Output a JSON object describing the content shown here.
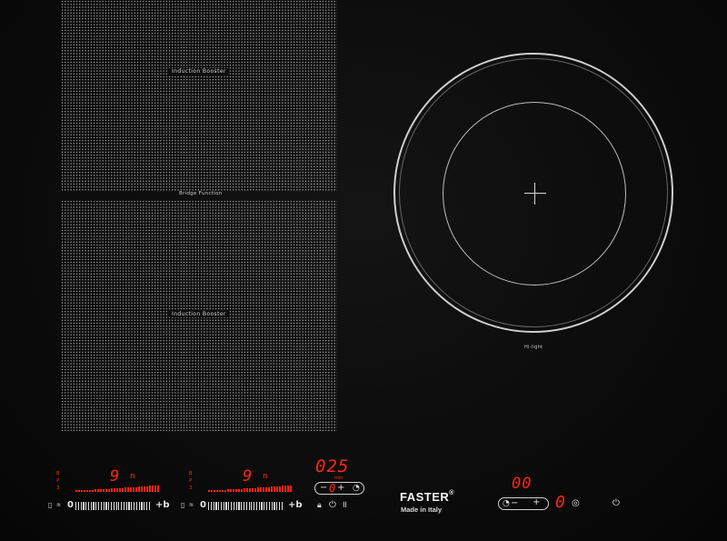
{
  "cooktop": {
    "zone_top_label": "Induction Booster",
    "zone_bottom_label": "Induction Booster",
    "bridge_label": "Bridge Function",
    "burner_label": "Hi-light"
  },
  "controls": {
    "left": {
      "level_marks": [
        "B",
        "P",
        "3"
      ],
      "display": "9",
      "suffix": "n",
      "slider_start": "0",
      "slider_end": "+b"
    },
    "middle": {
      "level_marks": [
        "B",
        "P",
        "3"
      ],
      "display": "9",
      "suffix": "n",
      "slider_start": "0",
      "slider_end": "+b"
    },
    "timer": {
      "display": "025",
      "unit": "min",
      "value": "0",
      "minus": "−",
      "plus": "+"
    },
    "right": {
      "timer_display": "00",
      "minus": "−",
      "plus": "+",
      "level": "0"
    }
  },
  "brand": {
    "name": "FASTER",
    "reg": "®",
    "tagline": "Made in Italy"
  },
  "colors": {
    "display_red": "#ff2618",
    "glass": "#0b0b0b",
    "print": "#d0d0d0"
  },
  "icons": [
    "lock-icon",
    "power-icon",
    "pause-icon",
    "timer-icon",
    "heat-icon",
    "child-lock-icon"
  ]
}
